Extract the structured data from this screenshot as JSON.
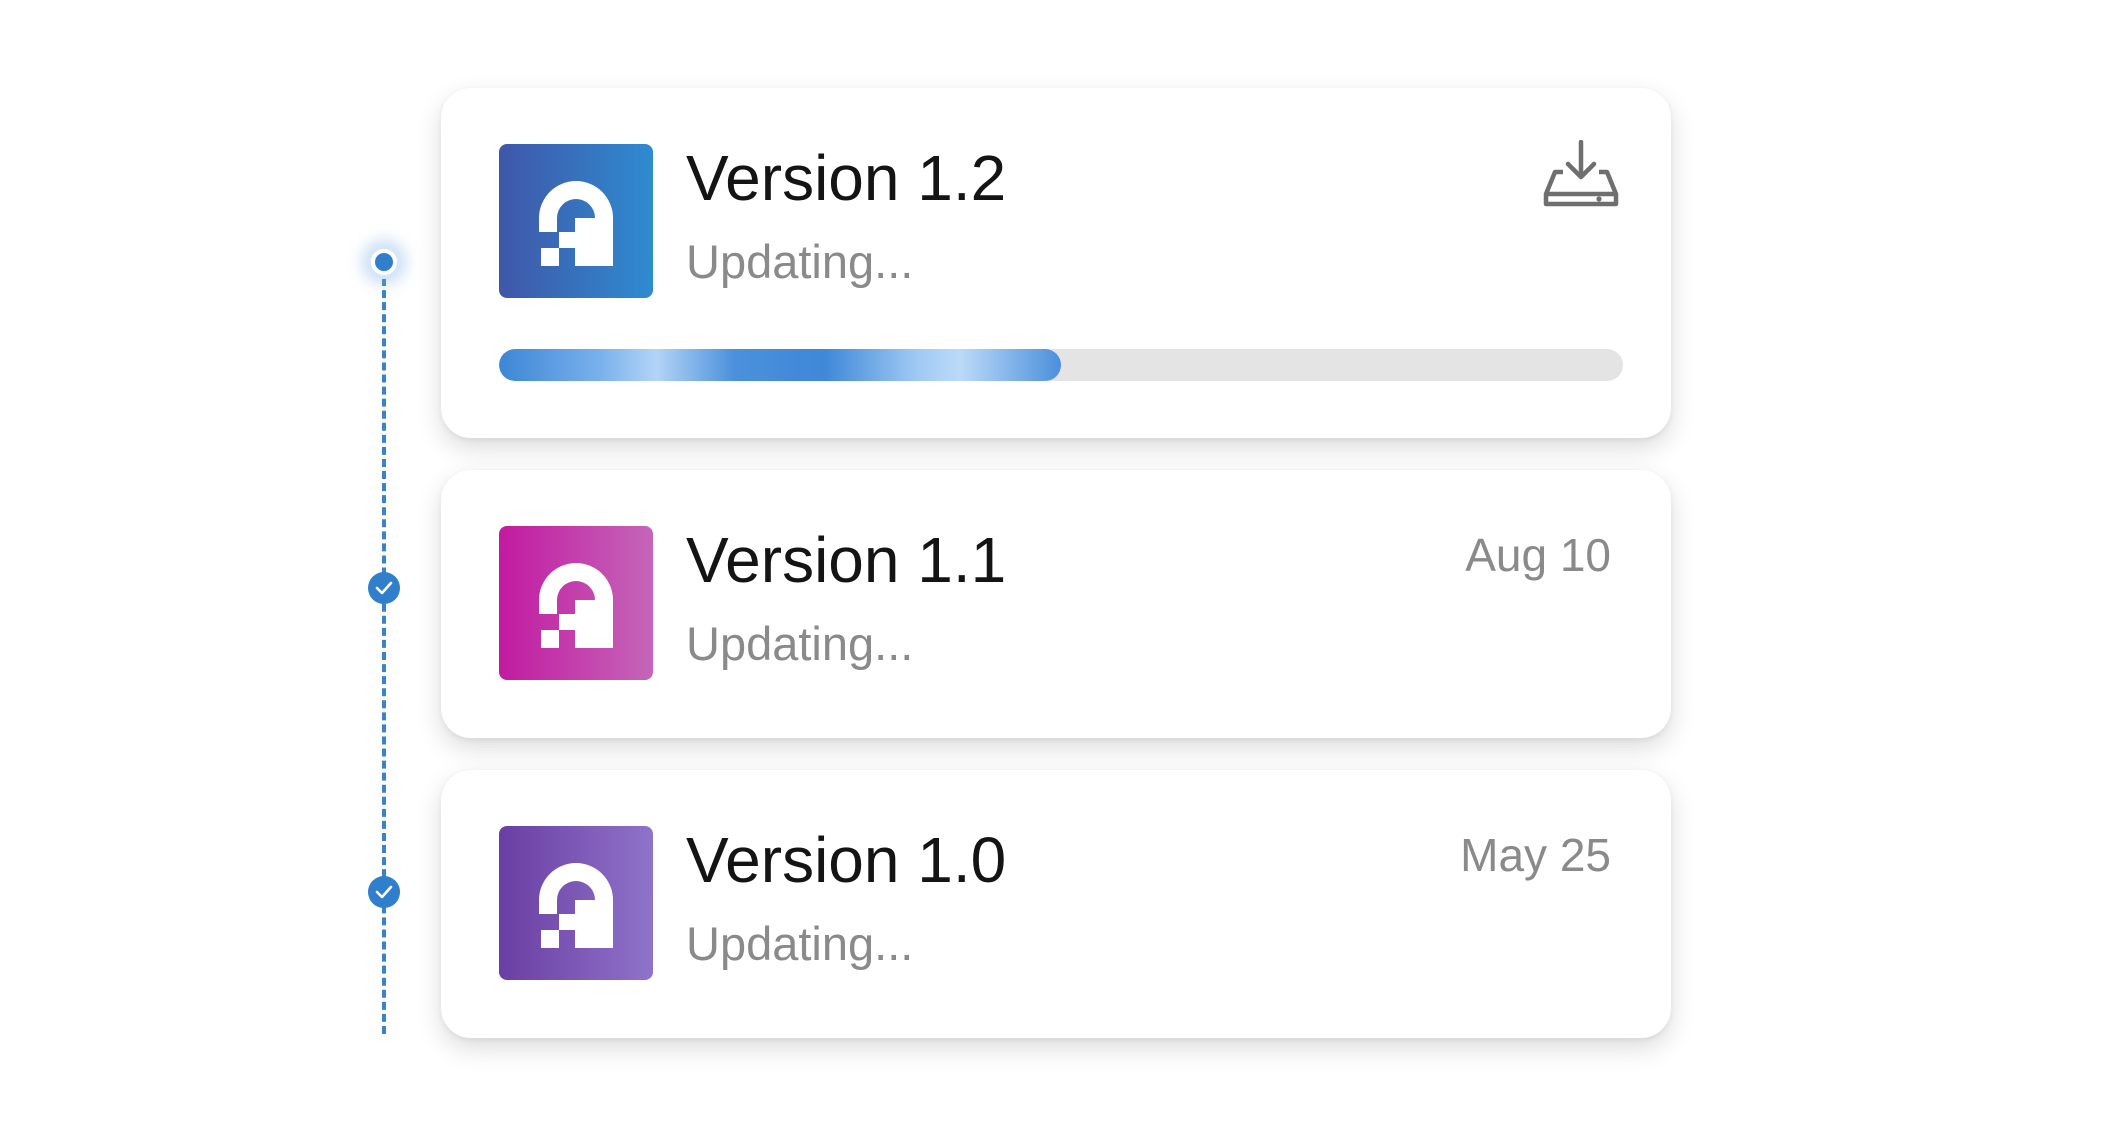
{
  "timeline": {
    "color": "#2f7fcd",
    "nodes": [
      {
        "state": "active",
        "icon": "current-dot-icon"
      },
      {
        "state": "done",
        "icon": "check-icon"
      },
      {
        "state": "done",
        "icon": "check-icon"
      }
    ]
  },
  "versions": [
    {
      "title": "Version 1.2",
      "status": "Updating...",
      "date": "",
      "action_icon": "download-icon",
      "progress_percent": 50,
      "icon_colors": [
        "#3f57a8",
        "#2f8bd0"
      ]
    },
    {
      "title": "Version 1.1",
      "status": "Updating...",
      "date": "Aug 10",
      "icon_colors": [
        "#c21aa0",
        "#c466b8"
      ]
    },
    {
      "title": "Version 1.0",
      "status": "Updating...",
      "date": "May 25",
      "icon_colors": [
        "#6a3ea3",
        "#8f73c9"
      ]
    }
  ],
  "colors": {
    "title_text": "#141414",
    "muted_text": "#8a8a8a",
    "progress_track": "#e4e4e4",
    "progress_fill": "#3d86d6"
  },
  "app_icon_name": "app-logo-icon"
}
